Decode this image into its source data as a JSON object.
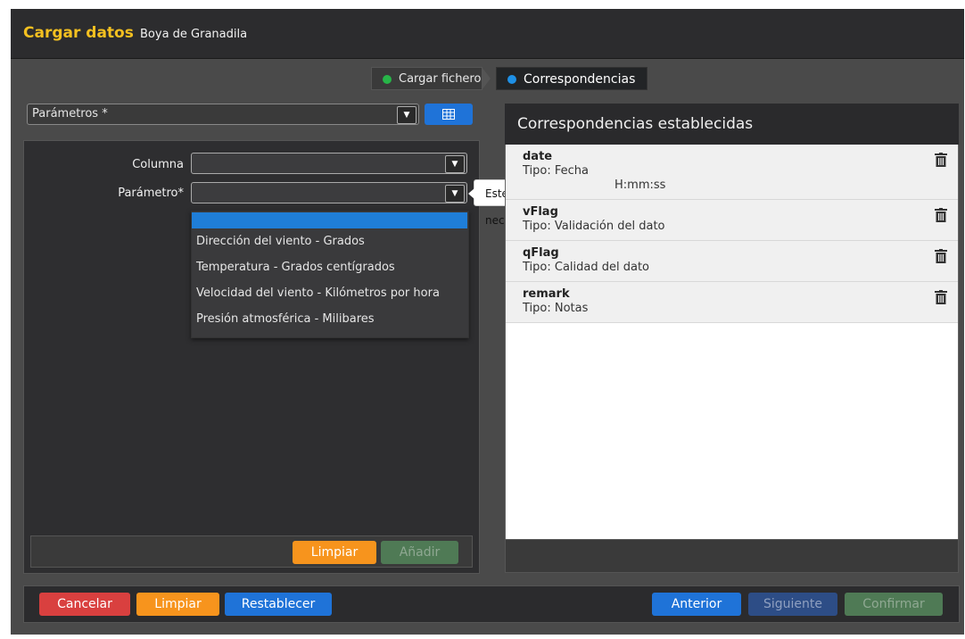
{
  "header": {
    "title": "Cargar datos",
    "subtitle": "Boya de Granadila"
  },
  "steps": [
    {
      "label": "Cargar fichero",
      "color": "#27b548",
      "state": "done"
    },
    {
      "label": "Correspondencias",
      "color": "#1e90e6",
      "state": "active"
    }
  ],
  "parameters_select": {
    "value": "Parámetros *",
    "table_icon": "table-grid-icon"
  },
  "form": {
    "column_label": "Columna",
    "column_value": "",
    "parameter_label": "Parámetro*",
    "parameter_value": "",
    "validation_tooltip": "Este valor es necesario.",
    "dropdown_options": [
      "",
      "Dirección del viento - Grados",
      "Temperatura - Grados centígrados",
      "Velocidad del viento - Kilómetros por hora",
      "Presión atmosférica - Milibares"
    ],
    "clear_label": "Limpiar",
    "add_label": "Añadir"
  },
  "mappings": {
    "title": "Correspondencias establecidas",
    "items": [
      {
        "name": "date",
        "type": "Tipo: Fecha",
        "extra": "H:mm:ss"
      },
      {
        "name": "vFlag",
        "type": "Tipo: Validación del dato",
        "extra": ""
      },
      {
        "name": "qFlag",
        "type": "Tipo: Calidad del dato",
        "extra": ""
      },
      {
        "name": "remark",
        "type": "Tipo: Notas",
        "extra": ""
      }
    ]
  },
  "bottom": {
    "cancel": "Cancelar",
    "clear": "Limpiar",
    "reset": "Restablecer",
    "previous": "Anterior",
    "next": "Siguiente",
    "confirm": "Confirmar"
  },
  "colors": {
    "title_accent": "#f4c020",
    "primary": "#1f73d8",
    "danger": "#d9403f",
    "warning": "#f7941d",
    "success_disabled": "#4f7a55",
    "primary_disabled": "#2d4d86"
  }
}
